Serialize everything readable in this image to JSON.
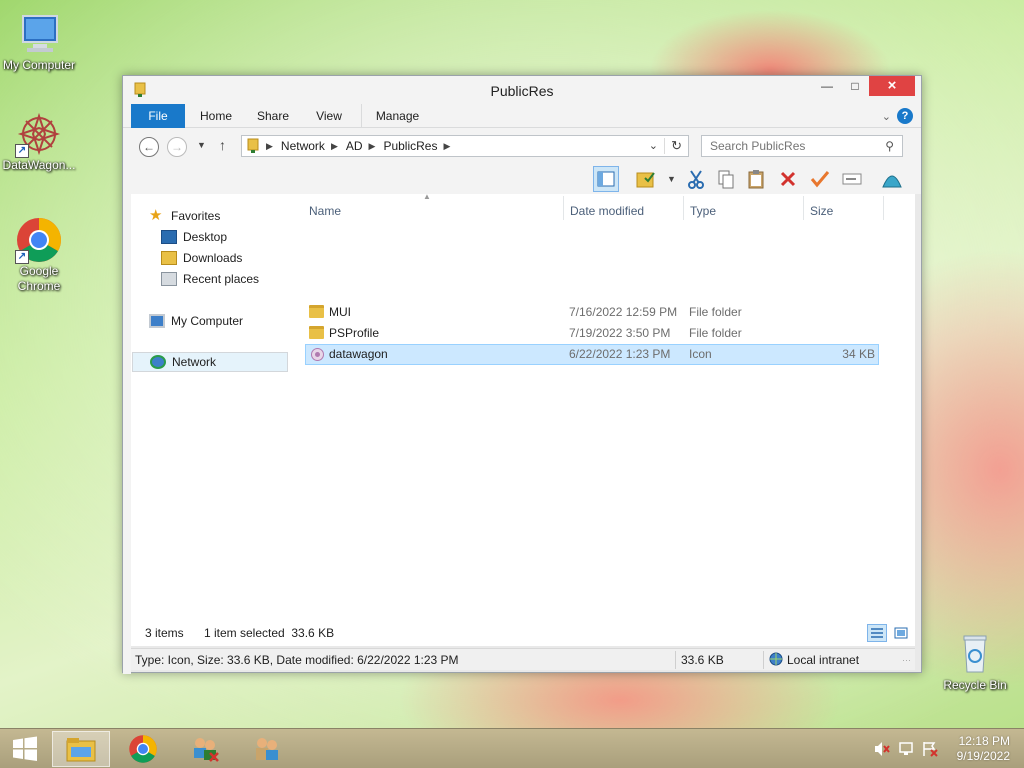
{
  "desktop": {
    "icons": [
      {
        "label": "My Computer",
        "icon": "computer-icon"
      },
      {
        "label": "DataWagon...",
        "icon": "datawagon-icon"
      },
      {
        "label": "Google Chrome",
        "icon": "chrome-icon"
      },
      {
        "label": "Recycle Bin",
        "icon": "recycle-bin-icon"
      }
    ]
  },
  "window": {
    "title": "PublicRes",
    "ribbon_tabs": [
      "File",
      "Home",
      "Share",
      "View",
      "Manage"
    ],
    "breadcrumb": [
      "Network",
      "AD",
      "PublicRes"
    ],
    "search_placeholder": "Search PublicRes",
    "nav": {
      "favorites": "Favorites",
      "desktop": "Desktop",
      "downloads": "Downloads",
      "recent": "Recent places",
      "computer": "My Computer",
      "network": "Network"
    },
    "columns": [
      "Name",
      "Date modified",
      "Type",
      "Size"
    ],
    "files": [
      {
        "name": "MUI",
        "date": "7/16/2022 12:59 PM",
        "type": "File folder",
        "size": ""
      },
      {
        "name": "PSProfile",
        "date": "7/19/2022 3:50 PM",
        "type": "File folder",
        "size": ""
      },
      {
        "name": "datawagon",
        "date": "6/22/2022 1:23 PM",
        "type": "Icon",
        "size": "34 KB"
      }
    ],
    "item_count": "3 items",
    "selection_info": "1 item selected  33.6 KB",
    "status_details": "Type: Icon, Size: 33.6 KB, Date modified: 6/22/2022 1:23 PM",
    "status_size": "33.6 KB",
    "status_zone": "Local intranet"
  },
  "taskbar": {
    "time": "12:18 PM",
    "date": "9/19/2022"
  },
  "colors": {
    "accent": "#1979ca",
    "close": "#e04343",
    "selection": "#cce8ff"
  }
}
